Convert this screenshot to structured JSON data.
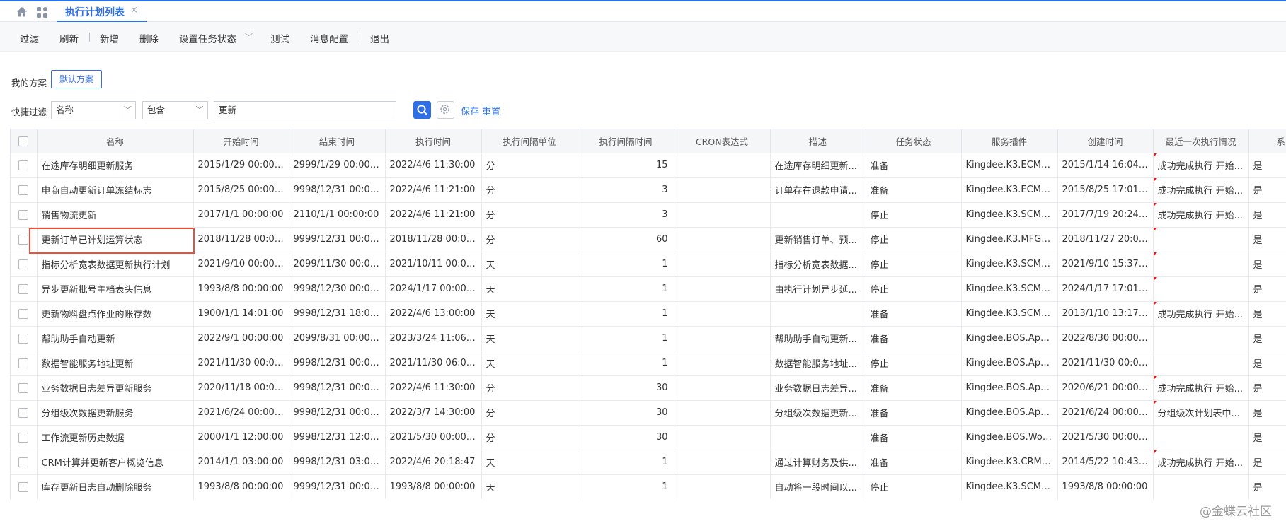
{
  "topbar": {
    "tab_title": "执行计划列表",
    "tab_close": "×"
  },
  "toolbar": {
    "filter": "过滤",
    "refresh": "刷新",
    "add": "新增",
    "delete": "删除",
    "set_status": "设置任务状态",
    "test": "测试",
    "message_config": "消息配置",
    "exit": "退出"
  },
  "scheme": {
    "label": "我的方案",
    "default_button": "默认方案"
  },
  "quick_filter": {
    "label": "快捷过滤",
    "field": "名称",
    "operator": "包含",
    "value": "更新",
    "save": "保存",
    "reset": "重置"
  },
  "table": {
    "columns": [
      "名称",
      "开始时间",
      "结束时间",
      "执行时间",
      "执行间隔单位",
      "执行间隔时间",
      "CRON表达式",
      "描述",
      "任务状态",
      "服务插件",
      "创建时间",
      "最近一次执行情况",
      "系"
    ],
    "rows": [
      {
        "name": "在途库存明细更新服务",
        "start": "2015/1/29 00:00:00",
        "end": "2999/1/29 00:00:00",
        "exec": "2022/4/6 11:30:00",
        "unit": "分",
        "interval": "15",
        "cron": "",
        "desc": "在途库存明细更新...",
        "status": "准备",
        "plugin": "Kingdee.K3.ECM.A...",
        "created": "2015/1/14 16:04:02",
        "last": "成功完成执行 开始...",
        "sys": "是",
        "flag": true
      },
      {
        "name": "电商自动更新订单冻结标志",
        "start": "2015/8/25 00:00:00",
        "end": "9998/12/31 00:00:...",
        "exec": "2022/4/6 11:21:00",
        "unit": "分",
        "interval": "3",
        "cron": "",
        "desc": "订单存在退款申请...",
        "status": "准备",
        "plugin": "Kingdee.K3.ECM.A...",
        "created": "2015/8/25 17:01:25",
        "last": "成功完成执行 开始...",
        "sys": "是",
        "flag": true
      },
      {
        "name": "销售物流更新",
        "start": "2017/1/1 00:00:00",
        "end": "2110/1/1 00:00:00",
        "exec": "2022/4/6 11:21:00",
        "unit": "分",
        "interval": "3",
        "cron": "",
        "desc": "",
        "status": "停止",
        "plugin": "Kingdee.K3.SCM.A...",
        "created": "2017/7/19 20:24:09",
        "last": "成功完成执行 开始...",
        "sys": "是",
        "flag": true
      },
      {
        "name": "更新订单已计划运算状态",
        "start": "2018/11/28 00:00:...",
        "end": "9999/12/31 00:00:...",
        "exec": "2018/11/28 00:00:...",
        "unit": "分",
        "interval": "60",
        "cron": "",
        "desc": "更新销售订单、预...",
        "status": "停止",
        "plugin": "Kingdee.K3.MFG.P...",
        "created": "2018/11/27 20:08:...",
        "last": "",
        "sys": "是",
        "flag": true
      },
      {
        "name": "指标分析宽表数据更新执行计划",
        "start": "2021/9/10 00:00:00",
        "end": "2099/11/30 00:00:...",
        "exec": "2021/10/11 00:00:...",
        "unit": "天",
        "interval": "1",
        "cron": "",
        "desc": "指标分析宽表数据...",
        "status": "停止",
        "plugin": "Kingdee.K3.SCM.T...",
        "created": "2021/9/10 15:37:52",
        "last": "",
        "sys": "是",
        "flag": true
      },
      {
        "name": "异步更新批号主档表头信息",
        "start": "1993/8/8 00:00:00",
        "end": "9998/12/30 00:00:...",
        "exec": "2024/1/17 00:00:00",
        "unit": "天",
        "interval": "1",
        "cron": "",
        "desc": "由执行计划异步延...",
        "status": "停止",
        "plugin": "Kingdee.K3.SCM.A...",
        "created": "2024/1/17 17:01:29",
        "last": "",
        "sys": "是",
        "flag": true
      },
      {
        "name": "更新物料盘点作业的账存数",
        "start": "1900/1/1 14:01:00",
        "end": "9998/12/31 18:00:...",
        "exec": "2022/4/6 13:00:00",
        "unit": "天",
        "interval": "1",
        "cron": "",
        "desc": "",
        "status": "准备",
        "plugin": "Kingdee.K3.SCM.A...",
        "created": "2013/1/10 13:17:45",
        "last": "成功完成执行 开始...",
        "sys": "是",
        "flag": true
      },
      {
        "name": "帮助助手自动更新",
        "start": "2022/9/1 00:00:00",
        "end": "2099/8/31 00:00:00",
        "exec": "2023/3/24 11:06:23",
        "unit": "天",
        "interval": "1",
        "cron": "",
        "desc": "帮助助手自动更新...",
        "status": "准备",
        "plugin": "Kingdee.BOS.App....",
        "created": "2022/8/30 00:00:00",
        "last": "",
        "sys": "是",
        "flag": false
      },
      {
        "name": "数据智能服务地址更新",
        "start": "2021/11/30 00:00:...",
        "end": "9998/12/31 00:00:...",
        "exec": "2021/11/30 06:00:...",
        "unit": "天",
        "interval": "1",
        "cron": "",
        "desc": "数据智能服务地址...",
        "status": "停止",
        "plugin": "Kingdee.BOS.App....",
        "created": "2021/11/30 00:00:...",
        "last": "",
        "sys": "是",
        "flag": false
      },
      {
        "name": "业务数据日志差异更新服务",
        "start": "2020/11/18 00:00:...",
        "end": "9998/12/31 00:00:...",
        "exec": "2022/4/6 11:30:00",
        "unit": "分",
        "interval": "30",
        "cron": "",
        "desc": "业务数据日志差异...",
        "status": "准备",
        "plugin": "Kingdee.BOS.Apm....",
        "created": "2020/6/21 00:00:00",
        "last": "成功完成执行 开始...",
        "sys": "是",
        "flag": true
      },
      {
        "name": "分组级次数据更新服务",
        "start": "2021/6/24 00:00:00",
        "end": "9998/12/31 00:00:00",
        "exec": "2022/3/7 14:30:00",
        "unit": "分",
        "interval": "30",
        "cron": "",
        "desc": "分组级次数据更新...",
        "status": "准备",
        "plugin": "Kingdee.BOS.App....",
        "created": "2021/6/24 00:00:00",
        "last": "分组级次计划表中...",
        "sys": "是",
        "flag": true
      },
      {
        "name": "工作流更新历史数据",
        "start": "2000/1/1 12:00:00",
        "end": "9998/12/31 12:00:...",
        "exec": "2021/5/30 00:00:00",
        "unit": "分",
        "interval": "30",
        "cron": "",
        "desc": "",
        "status": "准备",
        "plugin": "Kingdee.BOS.Wor....",
        "created": "2021/5/30 00:00:00",
        "last": "",
        "sys": "是",
        "flag": false
      },
      {
        "name": "CRM计算并更新客户概览信息",
        "start": "2014/1/1 03:00:00",
        "end": "9998/12/31 03:00:...",
        "exec": "2022/4/6 20:18:47",
        "unit": "天",
        "interval": "1",
        "cron": "",
        "desc": "通过计算财务及供...",
        "status": "准备",
        "plugin": "Kingdee.K3.CRM....",
        "created": "2014/5/22 10:43:12",
        "last": "成功完成执行 开始...",
        "sys": "是",
        "flag": true
      },
      {
        "name": "库存更新日志自动删除服务",
        "start": "1993/8/8 00:00:00",
        "end": "9999/12/31 00:00:...",
        "exec": "1993/8/8 00:00:00",
        "unit": "天",
        "interval": "1",
        "cron": "",
        "desc": "自动将一段时间以...",
        "status": "停止",
        "plugin": "Kingdee.K3.SCM.A...",
        "created": "1993/8/8 00:00:00",
        "last": "",
        "sys": "是",
        "flag": false
      }
    ]
  },
  "watermark": "@金蝶云社区",
  "colors": {
    "accent": "#2f6fe6",
    "highlight": "#e8503a"
  }
}
